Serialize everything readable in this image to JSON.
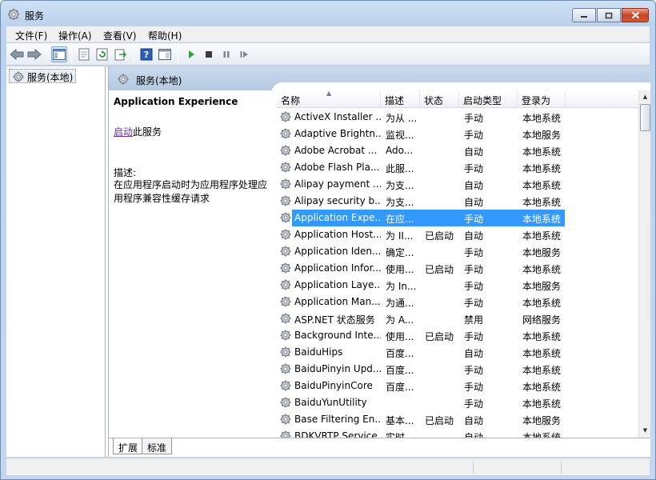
{
  "window": {
    "title": "服务"
  },
  "menu": [
    "文件(F)",
    "操作(A)",
    "查看(V)",
    "帮助(H)"
  ],
  "tree": {
    "item": "服务(本地)"
  },
  "pane": {
    "header": "服务(本地)"
  },
  "description": {
    "service_name": "Application Experience",
    "action_link": "启动",
    "action_suffix": "此服务",
    "label": "描述:",
    "text": "在应用程序启动时为应用程序处理应用程序兼容性缓存请求"
  },
  "columns": [
    "名称",
    "描述",
    "状态",
    "启动类型",
    "登录为"
  ],
  "services": [
    {
      "name": "ActiveX Installer ...",
      "desc": "为从 ...",
      "status": "",
      "startup": "手动",
      "logon": "本地系统"
    },
    {
      "name": "Adaptive Brightn...",
      "desc": "监视...",
      "status": "",
      "startup": "手动",
      "logon": "本地服务"
    },
    {
      "name": "Adobe Acrobat ...",
      "desc": "Ado...",
      "status": "",
      "startup": "自动",
      "logon": "本地系统"
    },
    {
      "name": "Adobe Flash Pla...",
      "desc": "此服...",
      "status": "",
      "startup": "手动",
      "logon": "本地系统"
    },
    {
      "name": "Alipay payment ...",
      "desc": "为支...",
      "status": "",
      "startup": "自动",
      "logon": "本地系统"
    },
    {
      "name": "Alipay security b...",
      "desc": "为支...",
      "status": "",
      "startup": "自动",
      "logon": "本地系统"
    },
    {
      "name": "Application Expe...",
      "desc": "在应...",
      "status": "",
      "startup": "手动",
      "logon": "本地系统",
      "selected": true
    },
    {
      "name": "Application Host...",
      "desc": "为 II...",
      "status": "已启动",
      "startup": "自动",
      "logon": "本地系统"
    },
    {
      "name": "Application Iden...",
      "desc": "确定...",
      "status": "",
      "startup": "手动",
      "logon": "本地服务"
    },
    {
      "name": "Application Infor...",
      "desc": "使用...",
      "status": "已启动",
      "startup": "手动",
      "logon": "本地系统"
    },
    {
      "name": "Application Laye...",
      "desc": "为 In...",
      "status": "",
      "startup": "手动",
      "logon": "本地服务"
    },
    {
      "name": "Application Man...",
      "desc": "为通...",
      "status": "",
      "startup": "手动",
      "logon": "本地系统"
    },
    {
      "name": "ASP.NET 状态服务",
      "desc": "为 A...",
      "status": "",
      "startup": "禁用",
      "logon": "网络服务"
    },
    {
      "name": "Background Inte...",
      "desc": "使用...",
      "status": "已启动",
      "startup": "手动",
      "logon": "本地系统"
    },
    {
      "name": "BaiduHips",
      "desc": "百度...",
      "status": "",
      "startup": "自动",
      "logon": "本地系统"
    },
    {
      "name": "BaiduPinyin Upd...",
      "desc": "百度...",
      "status": "",
      "startup": "手动",
      "logon": "本地系统"
    },
    {
      "name": "BaiduPinyinCore",
      "desc": "百度...",
      "status": "",
      "startup": "手动",
      "logon": "本地系统"
    },
    {
      "name": "BaiduYunUtility",
      "desc": "",
      "status": "",
      "startup": "手动",
      "logon": "本地系统"
    },
    {
      "name": "Base Filtering En...",
      "desc": "基本...",
      "status": "已启动",
      "startup": "自动",
      "logon": "本地服务"
    },
    {
      "name": "BDKVRTP Service",
      "desc": "实时...",
      "status": "",
      "startup": "自动",
      "logon": "本地系统"
    }
  ],
  "tabs": [
    "扩展",
    "标准"
  ],
  "colors": {
    "selection": "#3399ff",
    "link": "#6b2ea0",
    "header": "#b4c9e2"
  },
  "icons": [
    "services-icon",
    "back-icon",
    "forward-icon",
    "console-tree-icon",
    "properties-icon",
    "refresh-icon",
    "export-icon",
    "help-icon",
    "show-hide-icon",
    "play-icon",
    "stop-icon",
    "pause-icon",
    "restart-icon"
  ]
}
